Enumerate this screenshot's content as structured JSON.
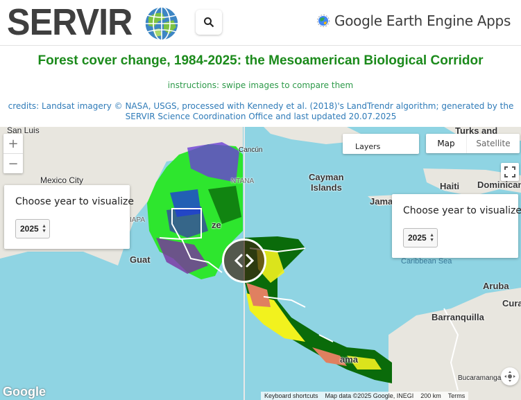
{
  "header": {
    "logo_text": "SERVIR",
    "brand_name": "Google Earth Engine Apps"
  },
  "title": "Forest cover change, 1984-2025: the Mesoamerican Biological Corridor",
  "instructions": "instructions: swipe images to compare them",
  "credits": "credits: Landsat imagery © NASA, USGS, processed with Kennedy et al. (2018)'s LandTrendr algorithm; generated by the SERVIR Science Coordination Office and last updated 20.07.2025",
  "map": {
    "zoom_in": "+",
    "zoom_out": "−",
    "left_panel": {
      "label": "Choose year to visualize",
      "year": "2025"
    },
    "right_panel": {
      "label": "Choose year to visualize",
      "year": "2025"
    },
    "layers_label": "Layers",
    "map_type": {
      "map": "Map",
      "satellite": "Satellite"
    },
    "places": {
      "san_luis": "San Luis",
      "mexico_city": "Mexico City",
      "cancun": "Cancún",
      "cayman": "Cayman",
      "islands": "Islands",
      "turks": "Turks and",
      "haiti": "Haiti",
      "dominican": "Dominican",
      "jama": "Jama",
      "aruba": "Aruba",
      "cura": "Cura",
      "barranquilla": "Barranquilla",
      "bucaramanga": "Bucaramanga",
      "caribbean_sea": "Caribbean Sea",
      "guat": "Guat",
      "iapa": "IAPA",
      "ntana": "NTANA",
      "ze": "ze",
      "ama": "ama"
    },
    "google_logo": "Google",
    "attribution": {
      "shortcuts": "Keyboard shortcuts",
      "map_data": "Map data ©2025 Google, INEGI",
      "scale": "200 km",
      "terms": "Terms"
    }
  },
  "colors": {
    "title_green": "#1b8a1b",
    "instruction_green": "#2e9a4a",
    "credit_blue": "#2f7bb8",
    "water": "#8fd4e3",
    "land": "#e8e6df",
    "forest_bright": "#2ee62e",
    "forest_dark": "#0a6b0a",
    "forest_loss_yellow": "#f2f21e",
    "forest_loss_salmon": "#e08060",
    "forest_purple": "#6a3fd6"
  }
}
